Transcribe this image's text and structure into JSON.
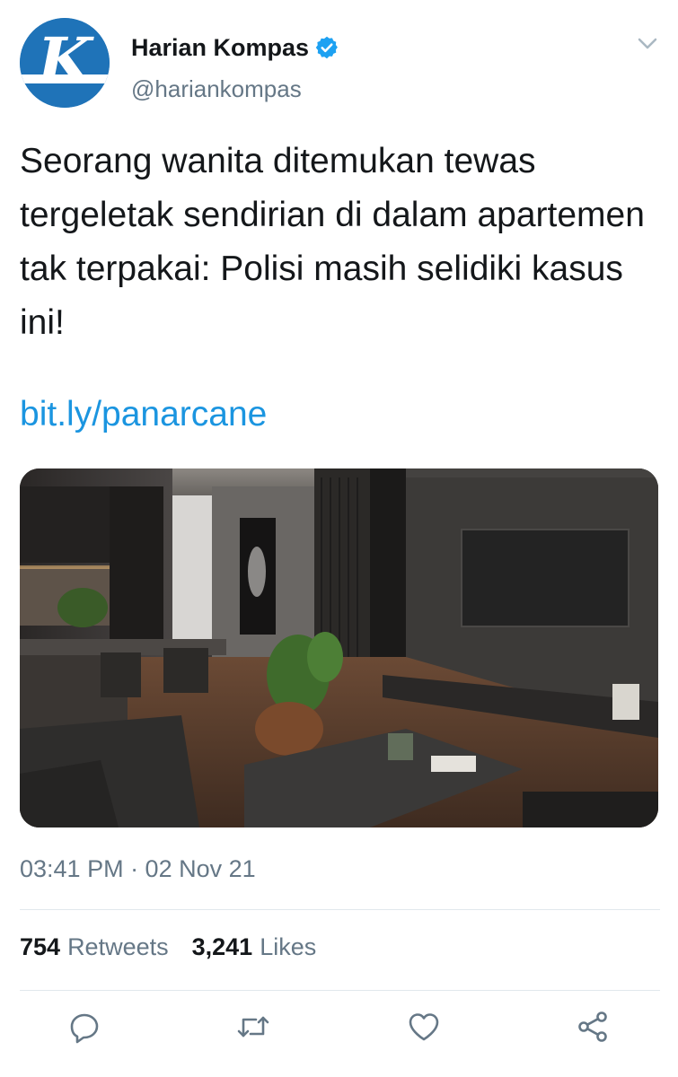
{
  "author": {
    "display_name": "Harian Kompas",
    "handle": "@hariankompas",
    "avatar_letter": "K",
    "verified": true,
    "avatar_color": "#1f73b8",
    "verified_color": "#1da1f2"
  },
  "tweet": {
    "text": "Seorang wanita ditemukan tewas tergeletak sendirian di dalam apartemen tak terpakai: Polisi masih selidiki kasus ini!",
    "link": "bit.ly/panarcane",
    "link_color": "#1b95e0",
    "timestamp": "03:41 PM · 02 Nov 21"
  },
  "stats": {
    "retweets_count": "754",
    "retweets_label": "Retweets",
    "likes_count": "3,241",
    "likes_label": "Likes"
  },
  "icons": {
    "menu": "chevron-down-icon",
    "reply": "reply-icon",
    "retweet": "retweet-icon",
    "like": "heart-icon",
    "share": "share-icon"
  }
}
